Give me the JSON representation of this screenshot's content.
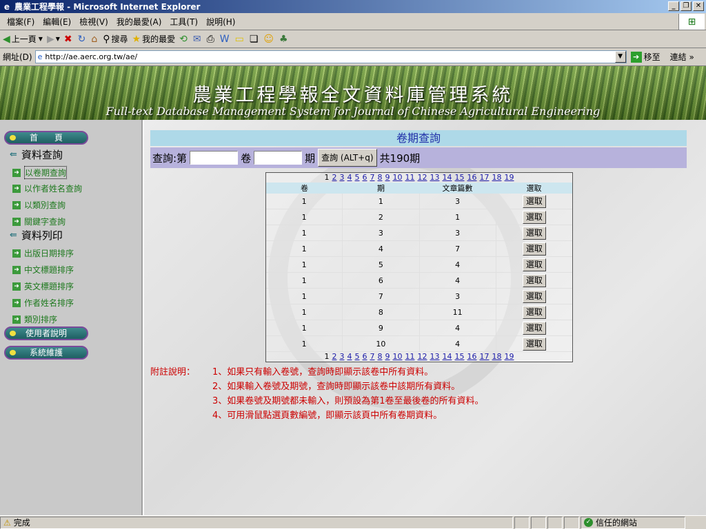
{
  "window": {
    "title": "農業工程學報 - Microsoft Internet Explorer"
  },
  "menu": [
    "檔案(F)",
    "編輯(E)",
    "檢視(V)",
    "我的最愛(A)",
    "工具(T)",
    "說明(H)"
  ],
  "toolbar": {
    "back": "上一頁",
    "search": "搜尋",
    "favorites": "我的最愛"
  },
  "address": {
    "label": "網址(D)",
    "url": "http://ae.aerc.org.tw/ae/",
    "go": "移至",
    "links": "連結"
  },
  "banner": {
    "title_cn": "農業工程學報全文資料庫管理系統",
    "title_en": "Full-text Database Management System for Journal of Chinese Agricultural Engineering"
  },
  "sidebar": {
    "home": "首　　頁",
    "query_title": "資料查詢",
    "query_items": [
      "以卷期查詢",
      "以作者姓名查詢",
      "以類別查詢",
      "關鍵字查詢"
    ],
    "print_title": "資料列印",
    "print_items": [
      "出版日期排序",
      "中文標題排序",
      "英文標題排序",
      "作者姓名排序",
      "類別排序"
    ],
    "user_guide": "使用者說明",
    "maintenance": "系統維護"
  },
  "main": {
    "header": "卷期查詢",
    "query": {
      "prefix": "查詢:第",
      "vol_label": "卷",
      "issue_label": "期",
      "button": "查詢 (ALT+q)",
      "total": "共190期"
    },
    "pages": [
      "1",
      "2",
      "3",
      "4",
      "5",
      "6",
      "7",
      "8",
      "9",
      "10",
      "11",
      "12",
      "13",
      "14",
      "15",
      "16",
      "17",
      "18",
      "19"
    ],
    "columns": [
      "卷",
      "期",
      "文章篇數",
      "選取"
    ],
    "rows": [
      {
        "vol": "1",
        "issue": "1",
        "count": "3"
      },
      {
        "vol": "1",
        "issue": "2",
        "count": "1"
      },
      {
        "vol": "1",
        "issue": "3",
        "count": "3"
      },
      {
        "vol": "1",
        "issue": "4",
        "count": "7"
      },
      {
        "vol": "1",
        "issue": "5",
        "count": "4"
      },
      {
        "vol": "1",
        "issue": "6",
        "count": "4"
      },
      {
        "vol": "1",
        "issue": "7",
        "count": "3"
      },
      {
        "vol": "1",
        "issue": "8",
        "count": "11"
      },
      {
        "vol": "1",
        "issue": "9",
        "count": "4"
      },
      {
        "vol": "1",
        "issue": "10",
        "count": "4"
      }
    ],
    "select_label": "選取",
    "notes_label": "附註說明：",
    "notes": [
      "1、如果只有輸入卷號，查詢時即顯示該卷中所有資料。",
      "2、如果輸入卷號及期號，查詢時即顯示該卷中該期所有資料。",
      "3、如果卷號及期號都未輸入，則預設為第1卷至最後卷的所有資料。",
      "4、可用滑鼠點選頁數編號，即顯示該頁中所有卷期資料。"
    ]
  },
  "status": {
    "text": "完成",
    "zone": "信任的網站"
  }
}
